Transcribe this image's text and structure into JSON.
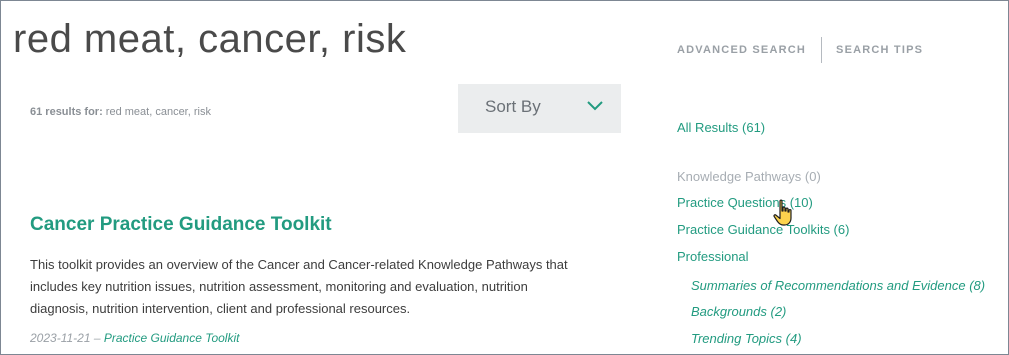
{
  "search": {
    "query": "red meat, cancer, risk"
  },
  "top_links": {
    "advanced": "ADVANCED SEARCH",
    "tips": "SEARCH TIPS"
  },
  "results_summary": {
    "count_label": "61 results for:",
    "query_echo": " red meat, cancer, risk"
  },
  "sort": {
    "label": "Sort By"
  },
  "result": {
    "title": "Cancer Practice Guidance Toolkit",
    "desc_lines": [
      "This toolkit provides an overview of the Cancer and Cancer-related Knowledge Pathways that",
      "includes key nutrition issues, nutrition assessment, monitoring and evaluation, nutrition",
      "diagnosis, nutrition intervention, client and professional resources."
    ],
    "date": "2023-11-21",
    "separator": " – ",
    "type": "Practice Guidance Toolkit"
  },
  "filters": {
    "all": "All Results (61)",
    "knowledge_pathways": "Knowledge Pathways (0)",
    "practice_questions": "Practice Questions (10)",
    "practice_guidance_toolkits": "Practice Guidance Toolkits (6)",
    "professional": "Professional",
    "sub": [
      "Summaries of Recommendations and Evidence (8)",
      "Backgrounds (2)",
      "Trending Topics (4)"
    ]
  },
  "colors": {
    "accent": "#229b80",
    "muted": "#a7adb3",
    "sort_bg": "#ebedee"
  },
  "icons": {
    "sort": "chevron-down-icon",
    "cursor": "hand-pointer-icon"
  }
}
